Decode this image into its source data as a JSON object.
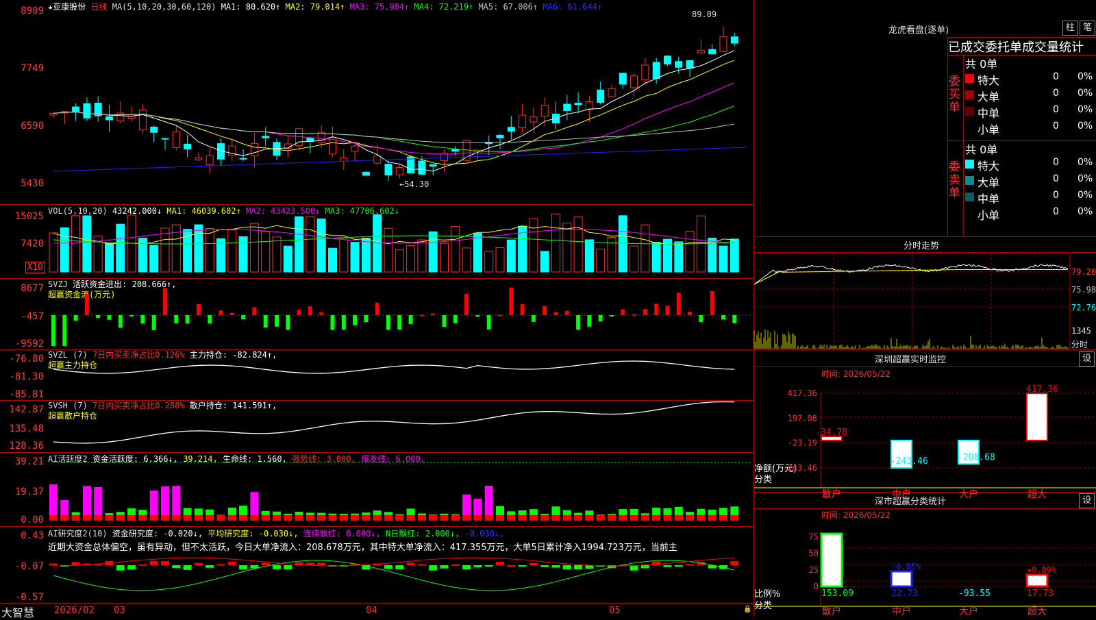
{
  "kline": {
    "star": "★",
    "stock": "亚康股份",
    "period": "日线",
    "ma_label": "MA(5,10,20,30,60,120)",
    "ma": [
      {
        "label": "MA1: 80.620↑",
        "color": "#ffffff"
      },
      {
        "label": "MA2: 79.014↑",
        "color": "#ffff00"
      },
      {
        "label": "MA3: 75.984↑",
        "color": "#ff00ff"
      },
      {
        "label": "MA4: 72.219↑",
        "color": "#00ff00"
      },
      {
        "label": "MA5: 67.006↑",
        "color": "#c0c0c0"
      },
      {
        "label": "MA6: 61.644↑",
        "color": "#2020ff"
      }
    ],
    "y_labels": [
      "8909",
      "7749",
      "6590",
      "5430"
    ],
    "high_label": "89.09",
    "low_label": "←54.30",
    "high": 89.09,
    "low": 54.3
  },
  "vol": {
    "label": "VOL(5,10,20)",
    "value": "43242.000↓",
    "ma1": "MA1: 46039.602↑",
    "ma2": "MA2: 43423.500↓",
    "ma3": "MA3: 47706.602↓",
    "y_labels": [
      "15025",
      "7420"
    ],
    "unit": "X10"
  },
  "svzj": {
    "label": "SVZJ",
    "name": "活跃资金进出: 208.666↑,",
    "sub": "超赢资金流(万元)",
    "y_labels": [
      "8677",
      "-457",
      "-9592"
    ]
  },
  "svzl": {
    "label": "SVZL (7)",
    "ratio": "7日内买卖净占比0.126%",
    "hold": "主力持仓: -82.824↑,",
    "sub": "超赢主力持仓",
    "y_labels": [
      "-76.80",
      "-81.30",
      "-85.81"
    ]
  },
  "svsh": {
    "label": "SVSH (7)",
    "ratio": "7日内买卖净占比0.288%",
    "hold": "散户持仓: 141.591↑,",
    "sub": "超赢散户持仓",
    "y_labels": [
      "142.87",
      "135.48",
      "128.36"
    ]
  },
  "ai1": {
    "label": "AI活跃度2",
    "v1": "资金活跃度: 6.366↓,",
    "v2": "39.214,",
    "v3": "生命线: 1.560,",
    "v4": "强势线: 3.000,",
    "v5": "爆发线: 6.000,",
    "y_labels": [
      "39.21",
      "19.37",
      "0.00"
    ]
  },
  "ai2": {
    "label": "AI研究度2(10)",
    "v1": "资金研究度: -0.020↓,",
    "v2": "平均研究度: -0.030↓,",
    "v3": "连续飘红: 0.000↓,",
    "v4": "N日飘红: 2.000↓,",
    "v5": "-0.030↓,",
    "comment": "近期大资金总体偏空，虽有异动，但不太活跃，今日大单净流入：208.678万元，其中特大单净流入：417.355万元，大单5日累计净入1994.723万元，当前主",
    "y_labels": [
      "0.43",
      "-0.07",
      "-0.57"
    ]
  },
  "xaxis": {
    "brand": "大智慧",
    "labels": [
      "2026/02",
      "03",
      "04",
      "05"
    ]
  },
  "dragon": {
    "title": "龙虎看盘(逐单)",
    "btn1": "柱",
    "btn2": "笔",
    "header": "已成交委托单成交量统计",
    "buy_label": "委买单",
    "sell_label": "委卖单",
    "buy_total": "共 0单",
    "sell_total": "共 0单",
    "buy_rows": [
      {
        "name": "特大",
        "count": "0",
        "pct": "0%",
        "color": "#ff0000"
      },
      {
        "name": "大单",
        "count": "0",
        "pct": "0%",
        "color": "#a00000"
      },
      {
        "name": "中单",
        "count": "0",
        "pct": "0%",
        "color": "#600000"
      },
      {
        "name": "小单",
        "count": "0",
        "pct": "0%",
        "color": ""
      }
    ],
    "sell_rows": [
      {
        "name": "特大",
        "count": "0",
        "pct": "0%",
        "color": "#00ffff"
      },
      {
        "name": "大单",
        "count": "0",
        "pct": "0%",
        "color": "#009090"
      },
      {
        "name": "中单",
        "count": "0",
        "pct": "0%",
        "color": "#006060"
      },
      {
        "name": "小单",
        "count": "0",
        "pct": "0%",
        "color": ""
      }
    ]
  },
  "intraday": {
    "title": "分时走势",
    "y_labels": [
      "79.20",
      "75.98",
      "72.76"
    ],
    "vol_label": "1345",
    "vol_unit": "分时"
  },
  "monitor": {
    "title": "深圳超赢实时监控",
    "btn": "设",
    "time": "时间: 2026/05/22",
    "y_labels": [
      "417.36",
      "197.08",
      "-23.19",
      "-243.46"
    ],
    "unit": "净额(万元)",
    "cat_label": "分类",
    "categories": [
      "散户",
      "中户",
      "大户",
      "超大"
    ],
    "values": [
      34.78,
      -243.46,
      -208.68,
      417.36
    ],
    "value_labels": [
      "34.78",
      "-243.46",
      "-208.68",
      "417.36"
    ]
  },
  "classify": {
    "title": "深市超赢分类统计",
    "btn": "设",
    "time": "时间: 2026/05/22",
    "y_labels": [
      "75",
      "50",
      "25",
      "0"
    ],
    "unit": "比例%",
    "cat_label": "分类",
    "categories": [
      "散户",
      "中户",
      "大户",
      "超大"
    ],
    "values": [
      153.09,
      22.73,
      -93.55,
      17.73
    ],
    "value_labels": [
      "153.09",
      "22.73",
      "-93.55",
      "17.73"
    ],
    "pct_labels": [
      "",
      "-0.05%",
      "",
      "+0.09%"
    ]
  }
}
